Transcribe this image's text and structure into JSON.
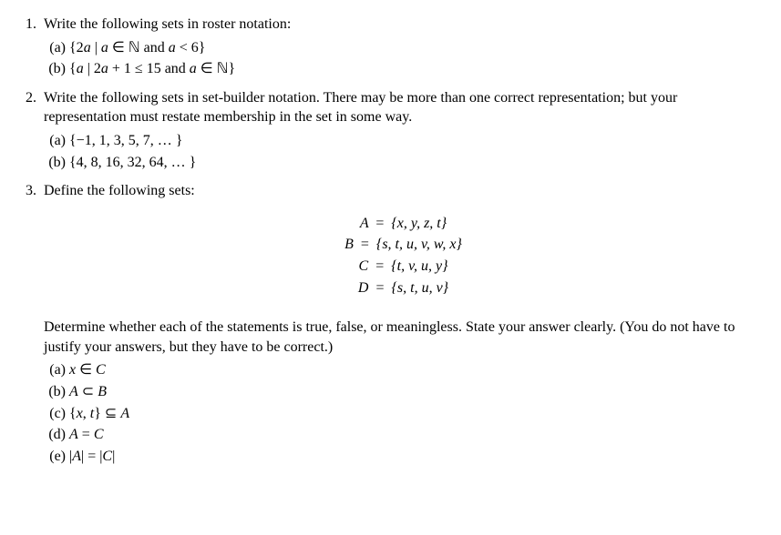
{
  "q1": {
    "prompt": "Write the following sets in roster notation:",
    "a": "{2a | a ∈ ℕ and a < 6}",
    "b": "{a | 2a + 1 ≤ 15 and a ∈ ℕ}"
  },
  "q2": {
    "prompt": "Write the following sets in set-builder notation. There may be more than one correct representation; but your representation must restate membership in the set in some way.",
    "a": "{−1, 1, 3, 5, 7, … }",
    "b": "{4, 8, 16, 32, 64, … }"
  },
  "q3": {
    "prompt": "Define the following sets:",
    "defs": {
      "A": "A = {x, y, z, t}",
      "B": "B = {s, t, u, v, w, x}",
      "C": "C = {t, v, u, y}",
      "D": "D = {s, t, u, v}"
    },
    "instr": "Determine whether each of the statements is true, false, or meaningless. State your answer clearly. (You do not have to justify your answers, but they have to be correct.)",
    "a": "x ∈ C",
    "b": "A ⊂ B",
    "c": "{x, t} ⊆ A",
    "d": "A = C",
    "e": "|A| = |C|"
  }
}
